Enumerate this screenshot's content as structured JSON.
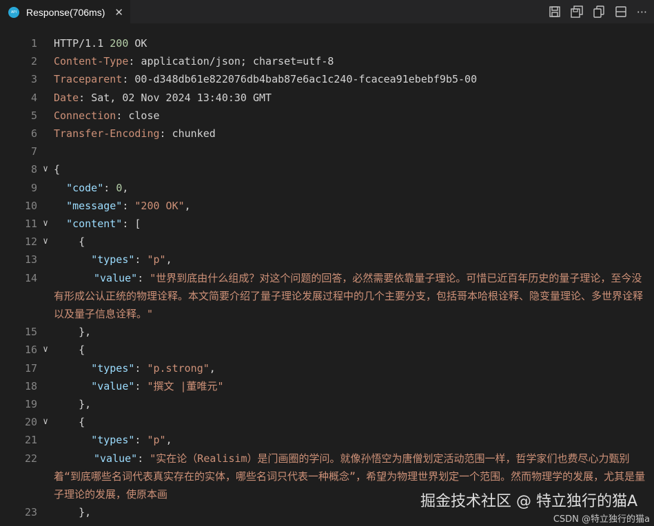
{
  "tab": {
    "icon": "rest-client-icon",
    "title": "Response(706ms)",
    "close": "✕"
  },
  "toolbar": {
    "icons": [
      "save-response-icon",
      "save-body-icon",
      "copy-icon",
      "split-layout-icon",
      "more-icon"
    ],
    "more_label": "···"
  },
  "response": {
    "status_line": {
      "protocol": "HTTP/1.1",
      "code": "200",
      "text": "OK"
    },
    "headers": [
      {
        "name": "Content-Type",
        "value": "application/json; charset=utf-8"
      },
      {
        "name": "Traceparent",
        "value": "00-d348db61e822076db4bab87e6ac1c240-fcacea91ebebf9b5-00"
      },
      {
        "name": "Date",
        "value": "Sat, 02 Nov 2024 13:40:30 GMT"
      },
      {
        "name": "Connection",
        "value": "close"
      },
      {
        "name": "Transfer-Encoding",
        "value": "chunked"
      }
    ],
    "body": {
      "code_key": "\"code\"",
      "code_value": "0",
      "message_key": "\"message\"",
      "message_value": "\"200 OK\"",
      "content_key": "\"content\"",
      "items": [
        {
          "types_key": "\"types\"",
          "types": "\"p\"",
          "value_key": "\"value\"",
          "value": "\"世界到底由什么组成？对这个问题的回答，必然需要依靠量子理论。可惜已近百年历史的量子理论，至今没有形成公认正统的物理诠释。本文简要介绍了量子理论发展过程中的几个主要分支，包括哥本哈根诠释、隐变量理论、多世界诠释以及量子信息诠释。\""
        },
        {
          "types_key": "\"types\"",
          "types": "\"p.strong\"",
          "value_key": "\"value\"",
          "value": "\"撰文 |董唯元\""
        },
        {
          "types_key": "\"types\"",
          "types": "\"p\"",
          "value_key": "\"value\"",
          "value": "\"实在论（Realisim）是门画圈的学问。就像孙悟空为唐僧划定活动范围一样，哲学家们也费尽心力甄别着“到底哪些名词代表真实存在的实体，哪些名词只代表一种概念”，希望为物理世界划定一个范围。然而物理学的发展，尤其是量子理论的发展，使原本画"
        }
      ]
    }
  },
  "line_numbers": [
    "1",
    "2",
    "3",
    "4",
    "5",
    "6",
    "7",
    "8",
    "9",
    "10",
    "11",
    "12",
    "13",
    "14",
    "15",
    "16",
    "17",
    "18",
    "19",
    "20",
    "21",
    "22",
    "23"
  ],
  "fold_glyph": "∨",
  "watermark": {
    "main": "掘金技术社区 @ 特立独行的猫A",
    "sub": "CSDN @特立独行的猫a"
  }
}
